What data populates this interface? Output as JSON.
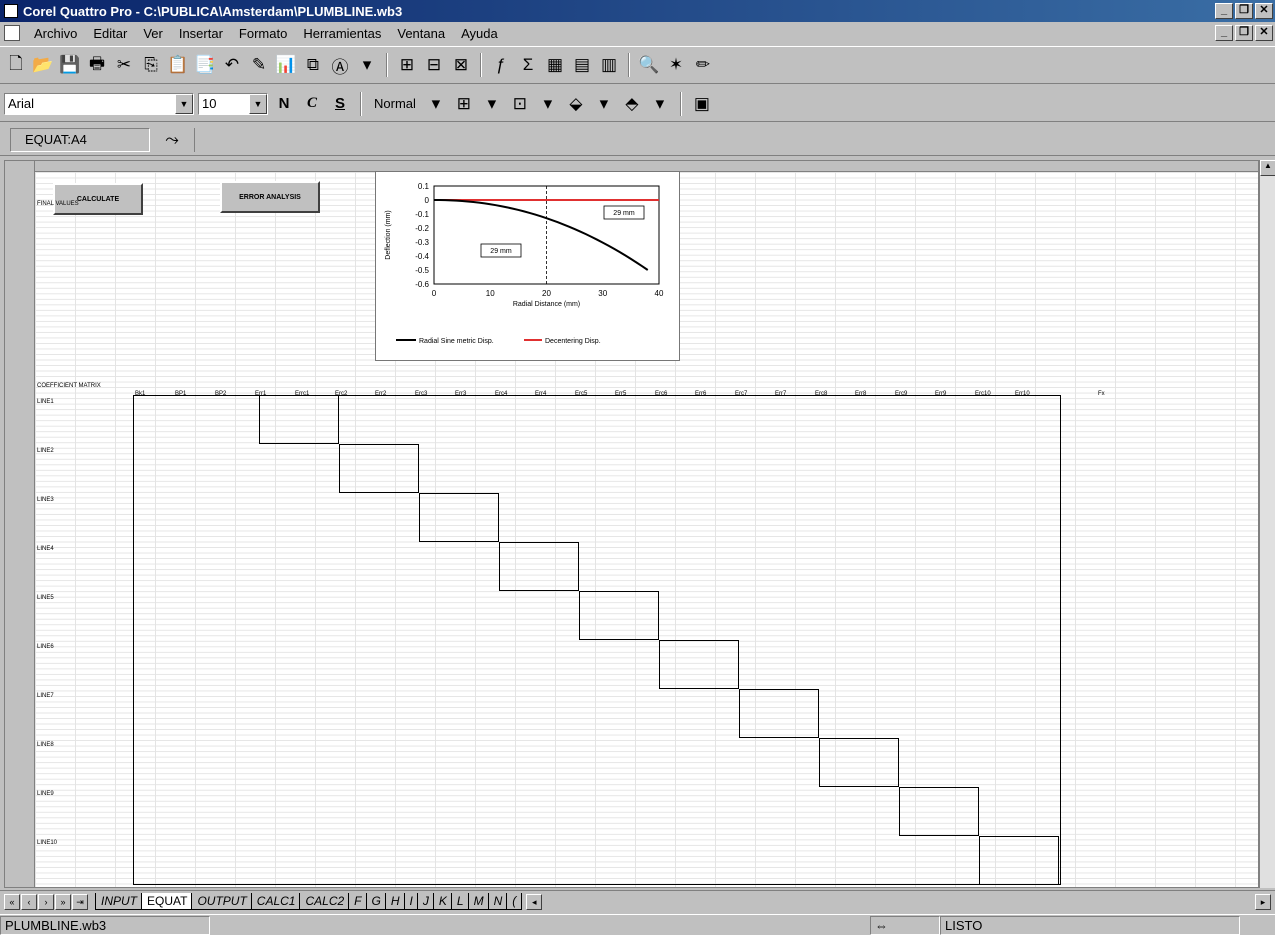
{
  "window": {
    "title": "Corel Quattro Pro - C:\\PUBLICA\\Amsterdam\\PLUMBLINE.wb3"
  },
  "menu": [
    "Archivo",
    "Editar",
    "Ver",
    "Insertar",
    "Formato",
    "Herramientas",
    "Ventana",
    "Ayuda"
  ],
  "format_bar": {
    "font": "Arial",
    "size": "10",
    "bold": "N",
    "italic": "C",
    "underline": "S",
    "style": "Normal"
  },
  "input_line": {
    "cell_ref": "EQUAT:A4"
  },
  "sheet": {
    "buttons": [
      "CALCULATE",
      "ERROR ANALYSIS"
    ],
    "final_values_label": "FINAL VALUES",
    "coefficient_label": "COEFFICIENT MATRIX",
    "row_labels": [
      "LINE1",
      "LINE2",
      "LINE3",
      "LINE4",
      "LINE5",
      "LINE6",
      "LINE7",
      "LINE8",
      "LINE9",
      "LINE10"
    ],
    "matrix_headers": [
      "Bk1",
      "BP1",
      "BP2",
      "Err1",
      "Errc1",
      "Erc2",
      "Err2",
      "Erc3",
      "Err3",
      "Erc4",
      "Err4",
      "Erc5",
      "Err5",
      "Erc6",
      "Err6",
      "Erc7",
      "Err7",
      "Erc8",
      "Err8",
      "Erc9",
      "Err9",
      "Erc10",
      "Err10"
    ],
    "fx_label": "Fx"
  },
  "chart": {
    "yticks": [
      "0.1",
      "0",
      "-0.1",
      "-0.2",
      "-0.3",
      "-0.4",
      "-0.5",
      "-0.6"
    ],
    "xticks": [
      "0",
      "10",
      "20",
      "30",
      "40"
    ],
    "ylabel": "Deflection (mm)",
    "xlabel": "Radial Distance (mm)",
    "box_right": "29 mm",
    "box_left": "29 mm",
    "legend": [
      "Radial Sine metric Disp.",
      "Decentering Disp."
    ],
    "color_line1": "#000000",
    "color_line2": "#e03030"
  },
  "tabs": [
    "INPUT",
    "EQUAT",
    "OUTPUT",
    "CALC1",
    "CALC2",
    "F",
    "G",
    "H",
    "I",
    "J",
    "K",
    "L",
    "M",
    "N",
    "("
  ],
  "active_tab": "EQUAT",
  "status": {
    "file": "PLUMBLINE.wb3",
    "mode": "LISTO"
  }
}
